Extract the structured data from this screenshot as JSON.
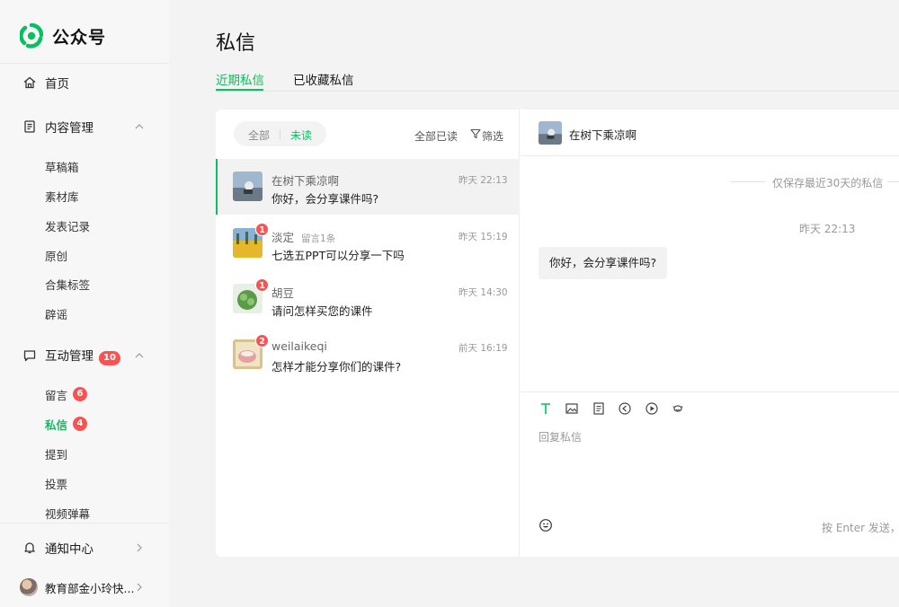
{
  "brand": {
    "name": "公众号",
    "accent": "#07c160",
    "badge_color": "#fa5151"
  },
  "sidebar": {
    "home": "首页",
    "content": {
      "label": "内容管理",
      "items": [
        "草稿箱",
        "素材库",
        "发表记录",
        "原创",
        "合集标签",
        "辟谣"
      ]
    },
    "interaction": {
      "label": "互动管理",
      "badge": "10",
      "items": [
        {
          "label": "留言",
          "badge": "6"
        },
        {
          "label": "私信",
          "badge": "4"
        },
        {
          "label": "提到",
          "badge": ""
        },
        {
          "label": "投票",
          "badge": ""
        },
        {
          "label": "视频弹幕",
          "badge": ""
        }
      ]
    },
    "notifications": "通知中心",
    "account": "教育部金小玲快..."
  },
  "page": {
    "title": "私信",
    "tabs": [
      "近期私信",
      "已收藏私信"
    ]
  },
  "list": {
    "filter_all": "全部",
    "filter_unread": "未读",
    "mark_all_read": "全部已读",
    "filter_label": "筛选",
    "conversations": [
      {
        "name": "在树下乘凉啊",
        "note": "",
        "time": "昨天 22:13",
        "message": "你好，会分享课件吗?",
        "unread": ""
      },
      {
        "name": "淡定",
        "note": "留言1条",
        "time": "昨天 15:19",
        "message": "七选五PPT可以分享一下吗",
        "unread": "1"
      },
      {
        "name": "胡豆",
        "note": "",
        "time": "昨天 14:30",
        "message": "请问怎样买您的课件",
        "unread": "1"
      },
      {
        "name": "weilaikeqi",
        "note": "",
        "time": "前天 16:19",
        "message": "怎样才能分享你们的课件?",
        "unread": "2"
      }
    ]
  },
  "chat": {
    "contact": "在树下乘凉啊",
    "retention_note": "仅保存最近30天的私信",
    "time": "昨天 22:13",
    "message": "你好，会分享课件吗?",
    "reply_placeholder": "回复私信",
    "send_hint": "按 Enter 发送，按"
  }
}
